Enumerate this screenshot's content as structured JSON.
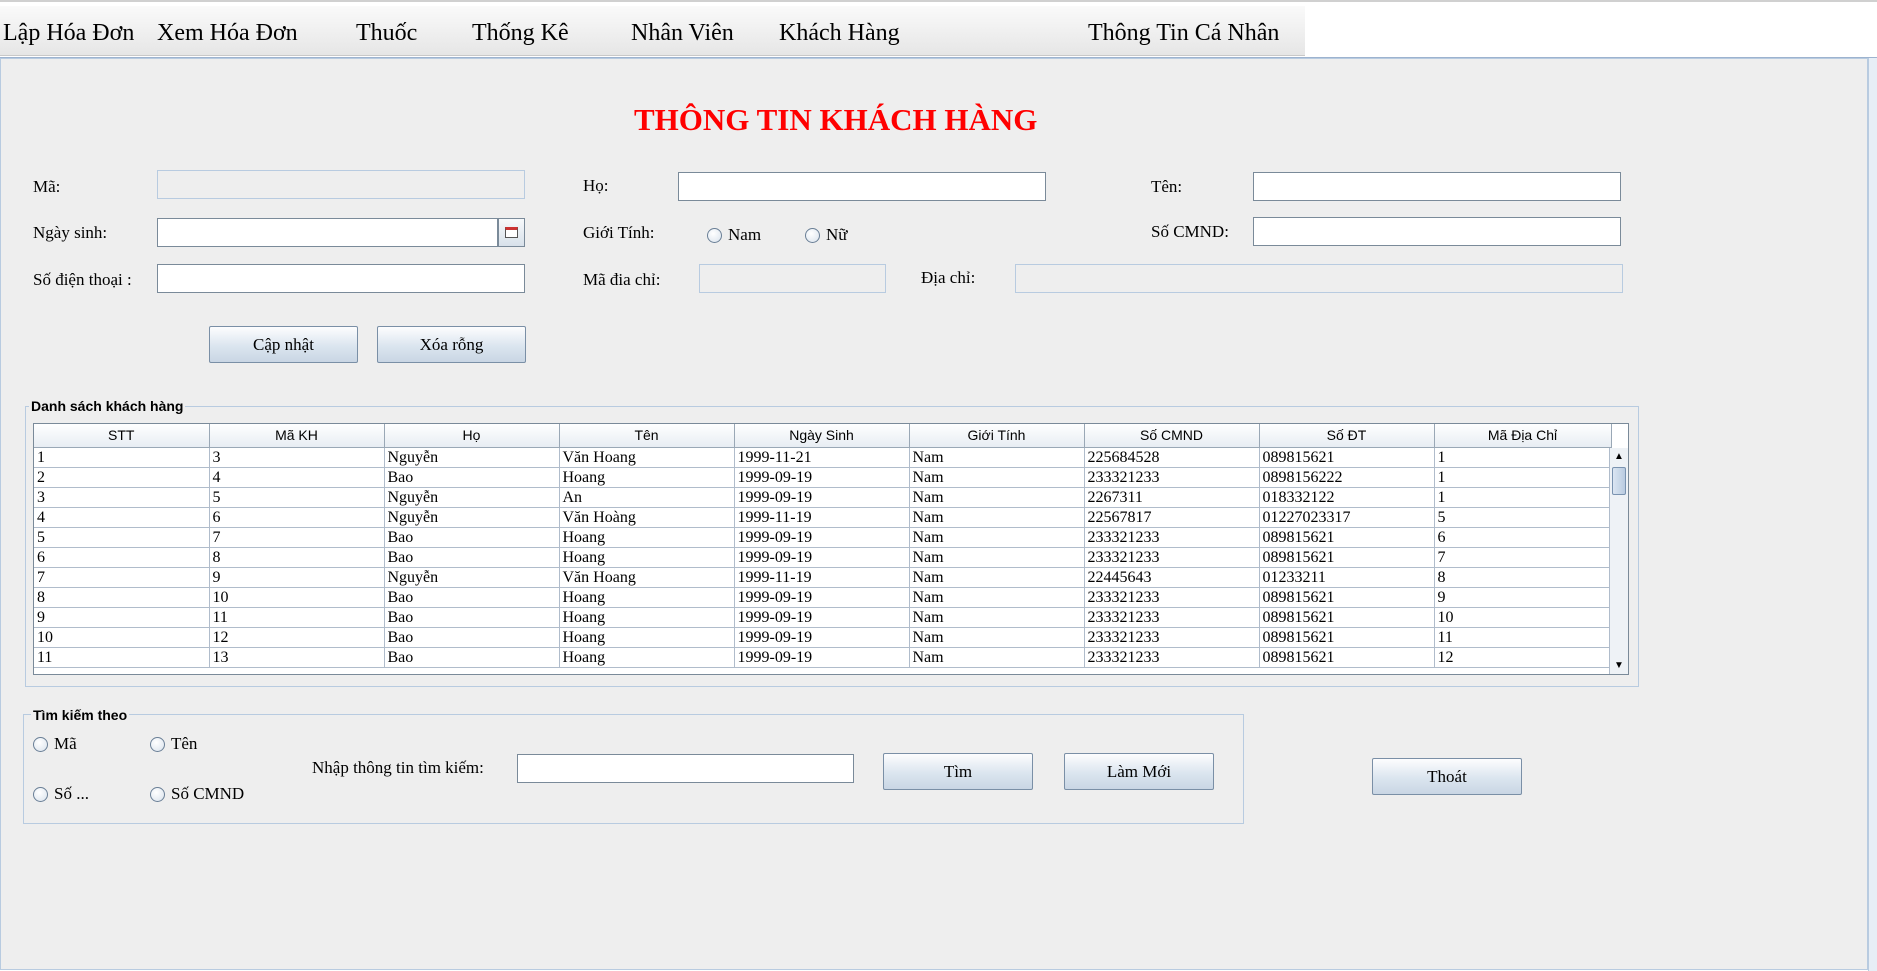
{
  "menu": [
    "Lập Hóa Đơn",
    "Xem Hóa Đơn",
    "Thuốc",
    "Thống Kê",
    "Nhân Viên",
    "Khách Hàng",
    "Thông Tin Cá Nhân"
  ],
  "title": "THÔNG TIN KHÁCH HÀNG",
  "form": {
    "ma_label": "Mã:",
    "ma_value": "",
    "ho_label": "Họ:",
    "ho_value": "",
    "ten_label": "Tên:",
    "ten_value": "",
    "ngaysinh_label": "Ngày sinh:",
    "ngaysinh_value": "",
    "gioitinh_label": "Giới Tính:",
    "gioitinh_nam": "Nam",
    "gioitinh_nu": "Nữ",
    "cmnd_label": "Số CMND:",
    "cmnd_value": "",
    "sdt_label": "Số điện thoại :",
    "sdt_value": "",
    "madiachi_label": "Mã đia chỉ:",
    "madiachi_value": "",
    "diachi_label": "Địa chỉ:",
    "diachi_value": "",
    "update_button": "Cập nhật",
    "clear_button": "Xóa rỗng"
  },
  "table": {
    "group_title": "Danh sách khách hàng",
    "columns": [
      "STT",
      "Mã KH",
      "Họ",
      "Tên",
      "Ngày Sinh",
      "Giới Tính",
      "Số CMND",
      "Số ĐT",
      "Mã Địa Chỉ"
    ],
    "rows": [
      [
        "1",
        "3",
        "Nguyễn",
        "Văn Hoang",
        "1999-11-21",
        "Nam",
        "225684528",
        "089815621",
        "1"
      ],
      [
        "2",
        "4",
        "Bao",
        "Hoang",
        "1999-09-19",
        "Nam",
        "233321233",
        "0898156222",
        "1"
      ],
      [
        "3",
        "5",
        "Nguyễn",
        "An",
        "1999-09-19",
        "Nam",
        "2267311",
        "018332122",
        "1"
      ],
      [
        "4",
        "6",
        "Nguyễn",
        "Văn Hoàng",
        "1999-11-19",
        "Nam",
        "22567817",
        "01227023317",
        "5"
      ],
      [
        "5",
        "7",
        "Bao",
        "Hoang",
        "1999-09-19",
        "Nam",
        "233321233",
        "089815621",
        "6"
      ],
      [
        "6",
        "8",
        "Bao",
        "Hoang",
        "1999-09-19",
        "Nam",
        "233321233",
        "089815621",
        "7"
      ],
      [
        "7",
        "9",
        "Nguyễn",
        "Văn Hoang",
        "1999-11-19",
        "Nam",
        "22445643",
        "01233211",
        "8"
      ],
      [
        "8",
        "10",
        "Bao",
        "Hoang",
        "1999-09-19",
        "Nam",
        "233321233",
        "089815621",
        "9"
      ],
      [
        "9",
        "11",
        "Bao",
        "Hoang",
        "1999-09-19",
        "Nam",
        "233321233",
        "089815621",
        "10"
      ],
      [
        "10",
        "12",
        "Bao",
        "Hoang",
        "1999-09-19",
        "Nam",
        "233321233",
        "089815621",
        "11"
      ],
      [
        "11",
        "13",
        "Bao",
        "Hoang",
        "1999-09-19",
        "Nam",
        "233321233",
        "089815621",
        "12"
      ]
    ]
  },
  "search": {
    "group_title": "Tìm kiếm theo",
    "opt_ma": "Mã",
    "opt_ten": "Tên",
    "opt_so": "Số ...",
    "opt_cmnd": "Số CMND",
    "input_label": "Nhập thông tin tìm kiếm:",
    "input_value": "",
    "find_button": "Tìm",
    "refresh_button": "Làm Mới"
  },
  "exit_button": "Thoát"
}
